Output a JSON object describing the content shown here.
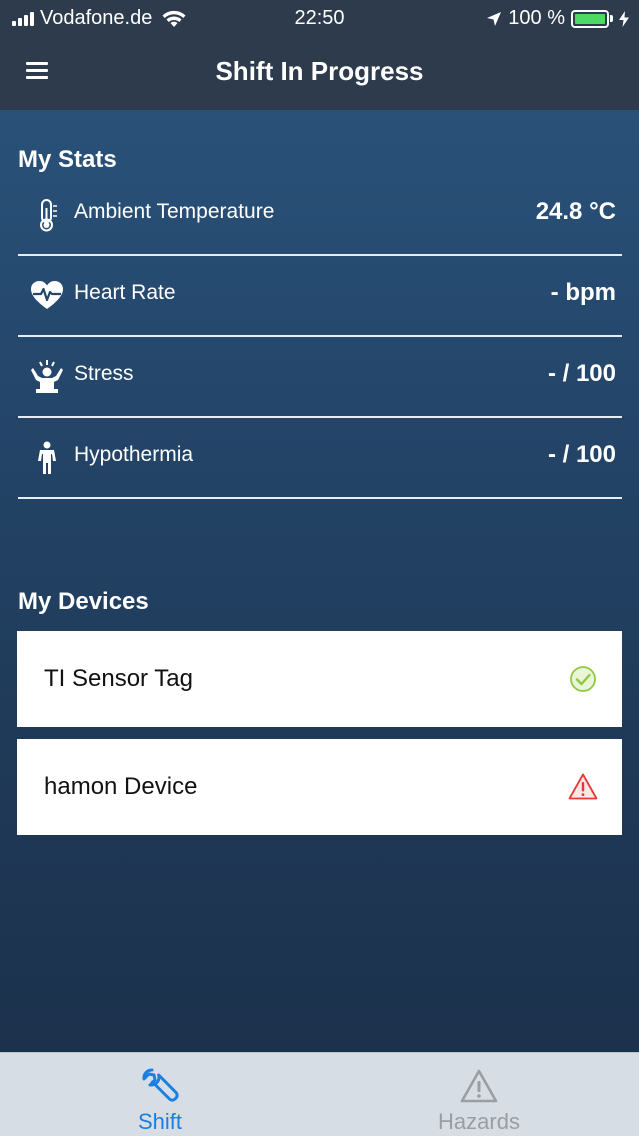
{
  "status_bar": {
    "carrier": "Vodafone.de",
    "time": "22:50",
    "battery": "100 %",
    "battery_level": 1.0
  },
  "navbar": {
    "title": "Shift In Progress",
    "menu_icon": "hamburger-menu-icon"
  },
  "stats": {
    "title": "My Stats",
    "items": [
      {
        "label": "Ambient Temperature",
        "value": "24.8 °C",
        "icon": "thermometer-icon"
      },
      {
        "label": "Heart Rate",
        "value": "- bpm",
        "icon": "heart-rate-icon"
      },
      {
        "label": "Stress",
        "value": "- / 100",
        "icon": "stress-icon"
      },
      {
        "label": "Hypothermia",
        "value": "- / 100",
        "icon": "person-icon"
      }
    ]
  },
  "devices": {
    "title": "My Devices",
    "items": [
      {
        "name": "TI Sensor Tag",
        "status": "ok",
        "status_icon": "checkmark-circle-icon",
        "status_color": "#8ccb3f"
      },
      {
        "name": "hamon Device",
        "status": "warning",
        "status_icon": "warning-triangle-icon",
        "status_color": "#e53935"
      }
    ]
  },
  "tabbar": {
    "tabs": [
      {
        "label": "Shift",
        "icon": "wrench-icon",
        "active": true,
        "color": "#1a7fe0"
      },
      {
        "label": "Hazards",
        "icon": "warning-triangle-icon",
        "active": false,
        "color": "#9a9ea3"
      }
    ]
  }
}
